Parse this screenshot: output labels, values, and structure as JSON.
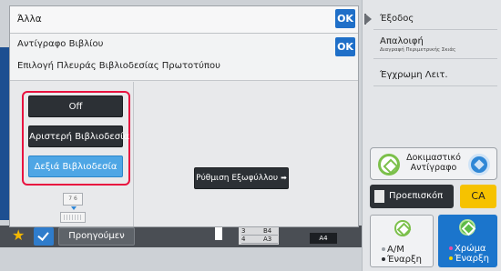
{
  "modal": {
    "title": "Άλλα",
    "ok_label": "OK",
    "sub": {
      "title": "Αντίγραφο Βιβλίου",
      "subtitle": "Επιλογή Πλευράς Βιβλιοδεσίας Πρωτοτύπου",
      "ok_label": "OK",
      "options": [
        "Off",
        "Αριστερή Βιβλιοδεσία",
        "Δεξιά Βιβλιοδεσία"
      ],
      "selected_option": "Δεξιά Βιβλιοδεσία",
      "binding_pages": "7 6",
      "cover_button": "Ρύθμιση Εξωφύλλου"
    }
  },
  "right_panel": {
    "items": [
      {
        "label": "Έξοδος",
        "sub": ""
      },
      {
        "label": "Απαλοιφή",
        "sub": "Διαγραφή Περιμετρικής Σκιάς"
      },
      {
        "label": "Έγχρωμη Λειτ.",
        "sub": ""
      }
    ],
    "test_copy": "Δοκιμαστικό Αντίγραφο",
    "preview": "Προεπισκόπ",
    "ca": "CA",
    "start_bw": [
      "A/M",
      "Έναρξη"
    ],
    "start_color": [
      "Χρώμα",
      "Έναρξη"
    ]
  },
  "bottom_bar": {
    "back_label": "Προηγούμεν",
    "tray": [
      {
        "num": "3",
        "size": "B4"
      },
      {
        "num": "4",
        "size": "A3"
      }
    ],
    "paper": "A4"
  },
  "colors": {
    "ok": "#1f6fc8",
    "highlight_frame": "#e8123f",
    "selected_option": "#4ea6e5",
    "ca": "#f6c200",
    "color_start": "#1b75cc"
  },
  "icons": [
    "star-icon",
    "check-icon",
    "green-diamond-icon",
    "blue-diamond-icon",
    "preview-document-icon",
    "arrow-right-icon"
  ]
}
